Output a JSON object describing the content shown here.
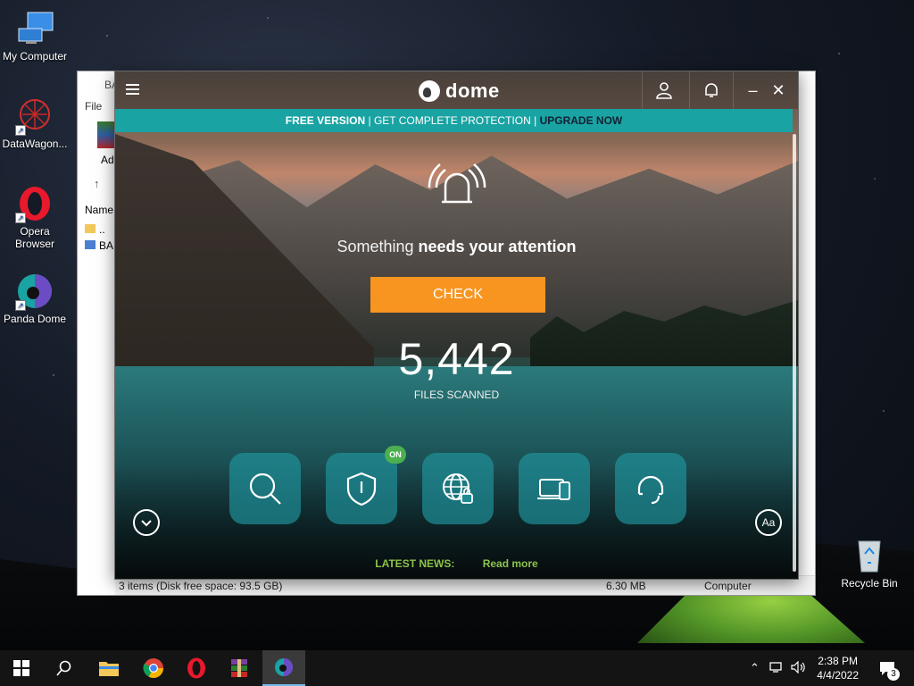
{
  "desktop": {
    "icons": [
      {
        "label": "My Computer"
      },
      {
        "label": "DataWagon..."
      },
      {
        "label": "Opera Browser"
      },
      {
        "label": "Panda Dome"
      },
      {
        "label": "Recycle Bin"
      }
    ]
  },
  "explorer": {
    "title": "BA",
    "menu": "File",
    "toolbar_label": "Ad",
    "column_header": "Name",
    "rows": [
      "..",
      "BA"
    ],
    "status_items": "3 items (Disk free space: 93.5 GB)",
    "status_size": "6.30 MB",
    "status_location": "Computer"
  },
  "dome": {
    "logo_text": "dome",
    "banner": {
      "free": "FREE VERSION",
      "sep": "|",
      "get": "GET COMPLETE PROTECTION",
      "upgrade": "UPGRADE NOW"
    },
    "attention_prefix": "Something",
    "attention_bold": "needs your attention",
    "check_label": "CHECK",
    "files_count": "5,442",
    "files_label": "FILES SCANNED",
    "on_badge": "ON",
    "font_button": "Aa",
    "news_label": "LATEST NEWS:",
    "news_link": "Read more"
  },
  "taskbar": {
    "time": "2:38 PM",
    "date": "4/4/2022",
    "notification_count": "3"
  },
  "colors": {
    "accent": "#1aa3a3",
    "check": "#f79520",
    "news": "#8bc34a",
    "on": "#4caf50"
  }
}
